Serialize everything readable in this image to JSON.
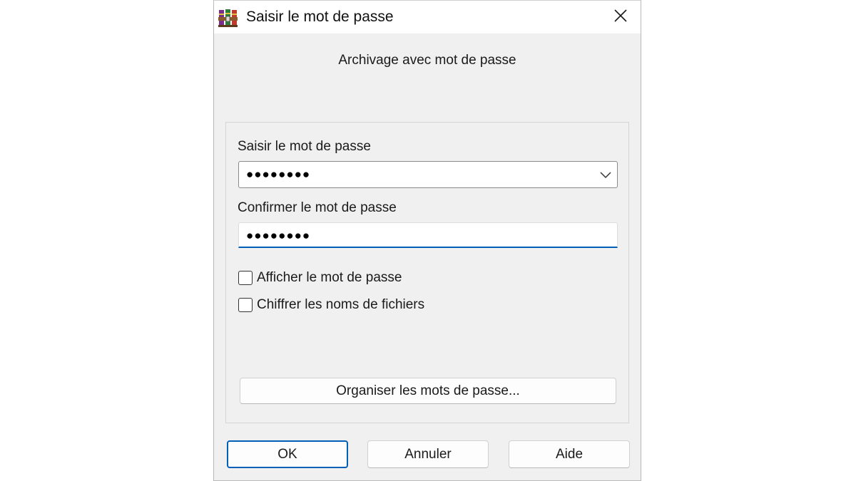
{
  "window": {
    "title": "Saisir le mot de passe",
    "app_icon": "winrar-books-icon",
    "close_icon": "close-icon"
  },
  "dialog": {
    "heading": "Archivage avec mot de passe"
  },
  "password": {
    "label": "Saisir le mot de passe",
    "value": "●●●●●●●●",
    "dropdown_icon": "chevron-down-icon"
  },
  "confirm": {
    "label": "Confirmer le mot de passe",
    "value": "●●●●●●●●"
  },
  "options": {
    "show_password": {
      "label": "Afficher le mot de passe",
      "checked": false
    },
    "encrypt_names": {
      "label": "Chiffrer les noms de fichiers",
      "checked": false
    }
  },
  "buttons": {
    "organize": "Organiser les mots de passe...",
    "ok": "OK",
    "cancel": "Annuler",
    "help": "Aide"
  },
  "colors": {
    "accent": "#005fb8",
    "dialog_bg": "#f0f0f0",
    "titlebar_bg": "#ffffff"
  }
}
